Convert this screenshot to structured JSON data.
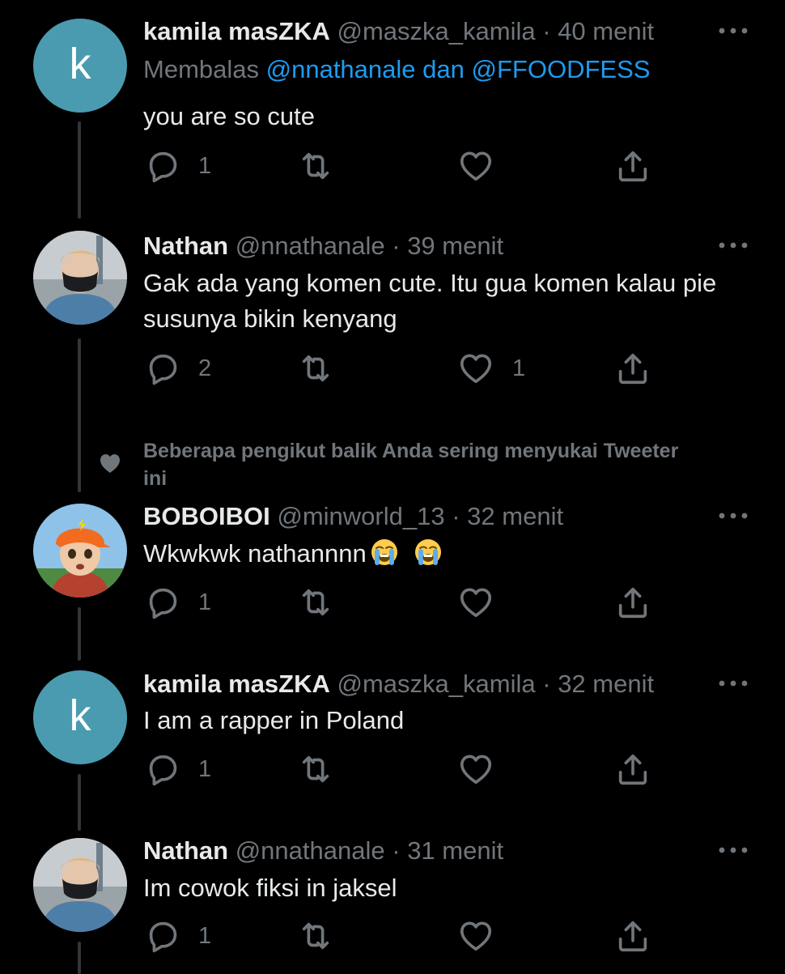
{
  "tweets": [
    {
      "avatar_letter": "k",
      "name": "kamila masZKA",
      "handle": "@maszka_kamila",
      "separator": "·",
      "time": "40 menit",
      "reply_prefix": "Membalas",
      "reply_mention_1": "@nnathanale",
      "reply_conj": "dan",
      "reply_mention_2": "@FFOODFESS",
      "text": "you are so cute",
      "replies": "1",
      "retweets": "",
      "likes": ""
    },
    {
      "name": "Nathan",
      "handle": "@nnathanale",
      "separator": "·",
      "time": "39 menit",
      "text": "Gak ada yang komen cute. Itu gua komen kalau pie susunya bikin kenyang",
      "replies": "2",
      "retweets": "",
      "likes": "1"
    },
    {
      "social_context": "Beberapa pengikut balik Anda sering menyukai Tweeter ini",
      "name": "BOBOIBOI",
      "handle": "@minworld_13",
      "separator": "·",
      "time": "32 menit",
      "text": "Wkwkwk nathannnn",
      "replies": "1",
      "retweets": "",
      "likes": ""
    },
    {
      "avatar_letter": "k",
      "name": "kamila masZKA",
      "handle": "@maszka_kamila",
      "separator": "·",
      "time": "32 menit",
      "text": "I am a rapper in Poland",
      "replies": "1",
      "retweets": "",
      "likes": ""
    },
    {
      "name": "Nathan",
      "handle": "@nnathanale",
      "separator": "·",
      "time": "31 menit",
      "text": "Im cowok fiksi in jaksel",
      "replies": "1",
      "retweets": "",
      "likes": ""
    }
  ],
  "icons": {
    "reply": "reply-icon",
    "retweet": "retweet-icon",
    "like": "heart-icon",
    "share": "share-icon",
    "more": "more-icon",
    "emoji": "loudly-crying-face-emoji"
  },
  "colors": {
    "background": "#000000",
    "text": "#e7e9ea",
    "secondary": "#71767b",
    "link": "#1d9bf0",
    "avatar_k": "#4a9bb0",
    "thread_line": "#333639"
  }
}
